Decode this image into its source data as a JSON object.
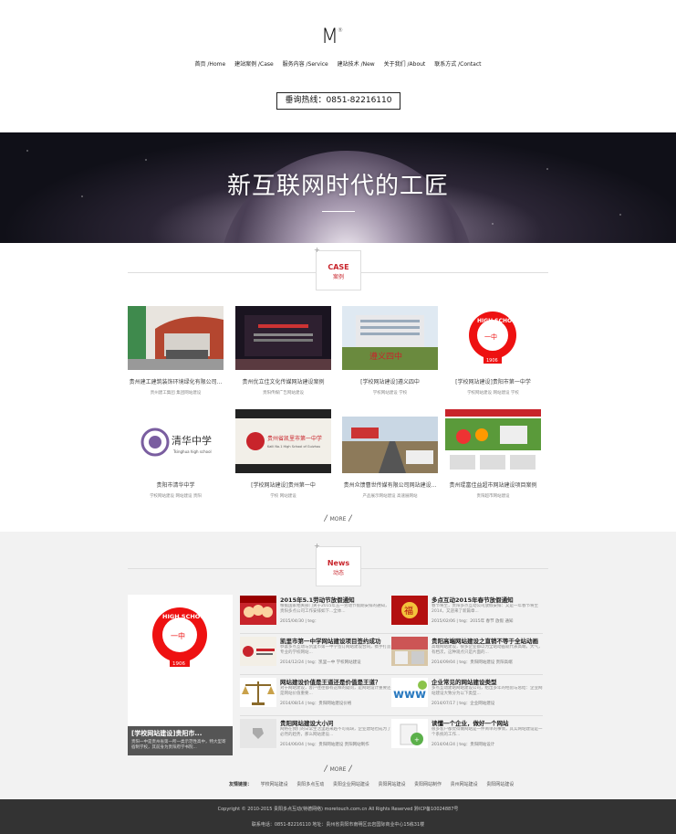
{
  "brand": {
    "logo": "M",
    "logo_mark": "®"
  },
  "nav": [
    {
      "label": "首页 /Home"
    },
    {
      "label": "建站案例 /Case"
    },
    {
      "label": "服务内容 /Service"
    },
    {
      "label": "建站技术 /New"
    },
    {
      "label": "关于我们 /About"
    },
    {
      "label": "联系方式 /Contact"
    }
  ],
  "hotline": "垂询热线：0851-82216110",
  "banner": {
    "title": "新互联网时代的工匠"
  },
  "case_section": {
    "en": "CASE",
    "cn": "案例",
    "more": "MORE",
    "items": [
      {
        "title": "贵州建工建筑装饰环境绿化有限公司...",
        "tags": "贵州建工集团 集团网站建设"
      },
      {
        "title": "贵州优立佳文化传媒网站建设案例",
        "tags": "贵阳传媒广告网站建设"
      },
      {
        "title": "[学校网站建设]遵义四中",
        "tags": "学校网站建设 学校"
      },
      {
        "title": "[学校网站建设]贵阳市第一中学",
        "tags": "学校网站建设 网站建设 学校"
      },
      {
        "title": "贵阳市清华中学",
        "tags": "学校网站建设 网站建设 贵阳"
      },
      {
        "title": "[学校网站建设]贵州第一中",
        "tags": "学校 网站建设"
      },
      {
        "title": "贵州众馈曹世传媒有限公司网站建设...",
        "tags": "产品展示网站建设 高速展网站"
      },
      {
        "title": "贵州琨富佳益超市网站建设项目案例",
        "tags": "贵阳超市网站建设"
      }
    ]
  },
  "news_section": {
    "en": "News",
    "cn": "动态",
    "more": "MORE",
    "feature": {
      "title": "[学校网站建设]贵阳市...",
      "desc": "贵阳一中是贵州省第一所一类示范性高中，特大型寄宿制学校，其前身为贵阳府学书院..."
    },
    "items": [
      {
        "title": "2015年5.1劳动节放假通知",
        "desc": "根据国家相关部门关于2015年五一劳动节假期安排的通知，贵阳多点公司工作安排如下...全体...",
        "meta": "2015/04/30  |  teg："
      },
      {
        "title": "多点互动2015年春节放假通知",
        "desc": "春节将至，贵阳多点互动公司放假安排：又是一年春节将至2014，又迎来了新篇章...",
        "meta": "2015/02/06  |  teg：2015年 春节 放假 通知"
      },
      {
        "title": "凯里市第一中学网站建设项目签约成功",
        "desc": "恭喜多点互动与凯里市第一中学签订网站建设合同，携手打造专业的学校网站...",
        "meta": "2014/12/24  |  teg：凯里一中 学校网站建设"
      },
      {
        "title": "贵阳高端网站建设之直销不等于全站动画",
        "desc": "高端网站建设，很多企业都以为全站动画就代表高端，大气，有档次，这种观点只是片面的...",
        "meta": "2014/09/04  |  teg：贵阳网站建设 贵阳高端"
      },
      {
        "title": "网站建设价值是王道还是价值是王道？",
        "desc": "对于网站建设，客户往往都有这样的疑问，是网站设计重要还是网站价值重要...",
        "meta": "2014/08/14  |  teg：贵阳网站建设价格"
      },
      {
        "title": "企业常见的网站建设类型",
        "desc": "多点互动建站网站建设公司，给出多年的经验与总结：企业网站建设大致分为以下类型...",
        "meta": "2014/07/17  |  teg：企业网站建设"
      },
      {
        "title": "贵阳网站建设大小问",
        "desc": "网络在我们的日常生活里越来越不可或缺，企业建站也成为了必然的趋势，那么网站建设...",
        "meta": "2014/06/04  |  teg：贵阳网站建设 贵阳网站制作"
      },
      {
        "title": "读懂一个企业，做好一个网站",
        "desc": "很多客户都觉得做网站是一件简单的事情，其实网站建设是一个系统的工作...",
        "meta": "2014/04/24  |  teg：贵阳网站设计"
      }
    ]
  },
  "friend_links": {
    "label": "友情链接：",
    "items": [
      "学校网站建设",
      "贵阳多点互动",
      "贵阳企业网站建设",
      "贵阳网站建设",
      "贵阳网站制作",
      "贵州网站建设",
      "贵阳网站建设"
    ]
  },
  "footer": {
    "copyright": "Copyright © 2010-2015  贵阳多点互动(特德网络) moretouch.com.cn All Rights Reserved 黔ICP备10024887号",
    "contact": "联系电话：0851-82216110 地址：贵州省贵阳市南明区云岩国际商业中心15栋31楼"
  },
  "colors": {
    "accent": "#c8242b",
    "footer_bg": "#333333",
    "news_bg": "#f2f2f2"
  }
}
